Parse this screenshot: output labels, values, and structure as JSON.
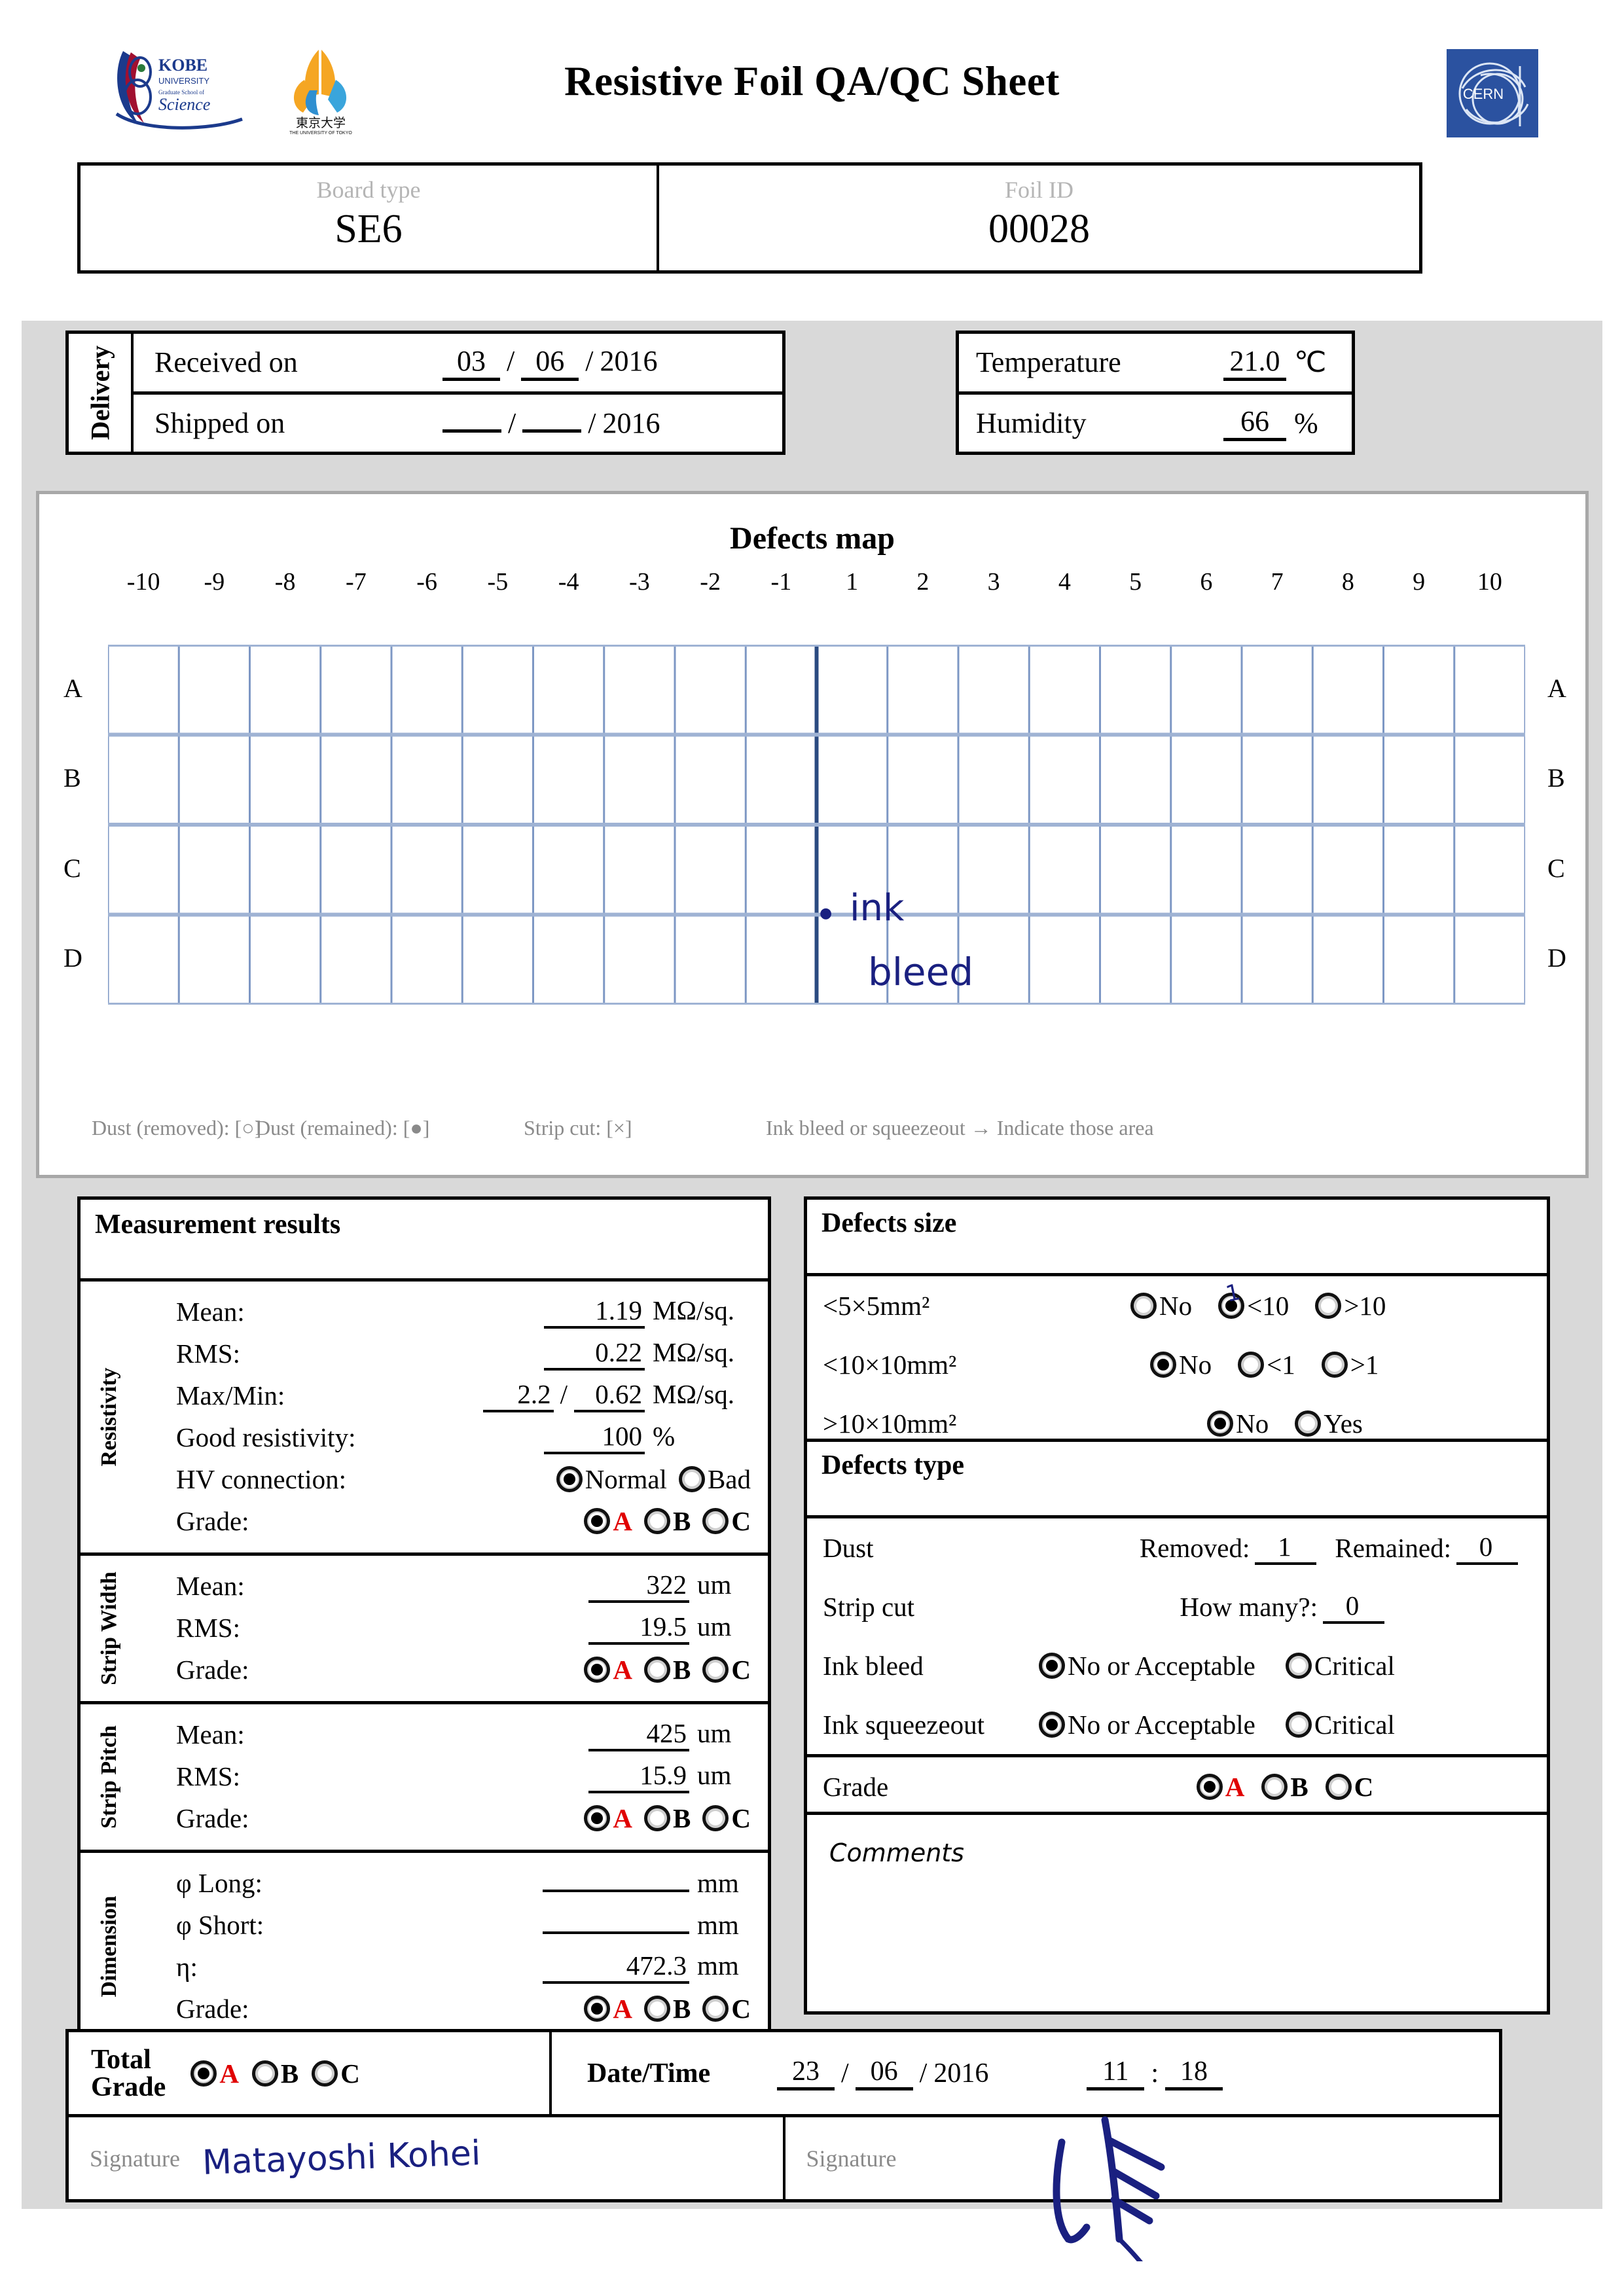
{
  "header": {
    "title": "Resistive Foil QA/QC Sheet",
    "logo_kobe": "kobe-university-logo",
    "logo_tokyo": "tokyo-university-logo",
    "logo_cern": "cern-logo",
    "cern_text": "CERN"
  },
  "identification": {
    "board_type_label": "Board type",
    "board_type_value": "SE6",
    "foil_id_label": "Foil ID",
    "foil_id_value": "00028"
  },
  "delivery": {
    "section_label": "Delivery",
    "received_label": "Received on",
    "received_day": "03",
    "received_month": "06",
    "received_year": "2016",
    "shipped_label": "Shipped on",
    "shipped_day": "",
    "shipped_month": "",
    "shipped_year": "2016"
  },
  "environment": {
    "temperature_label": "Temperature",
    "temperature_value": "21.0",
    "temperature_unit": "℃",
    "humidity_label": "Humidity",
    "humidity_value": "66",
    "humidity_unit": "%"
  },
  "defects_map": {
    "title": "Defects map",
    "columns": [
      "-10",
      "-9",
      "-8",
      "-7",
      "-6",
      "-5",
      "-4",
      "-3",
      "-2",
      "-1",
      "1",
      "2",
      "3",
      "4",
      "5",
      "6",
      "7",
      "8",
      "9",
      "10"
    ],
    "rows": [
      "A",
      "B",
      "C",
      "D"
    ],
    "annotations": [
      {
        "text": "ink",
        "row": "C",
        "col": "2"
      },
      {
        "text": "bleed",
        "row": "D",
        "col": "2"
      }
    ],
    "legend": [
      "Dust (removed): [○]",
      "Dust (remained): [●]",
      "Strip cut: [×]",
      "Ink bleed or squeezeout → Indicate those area"
    ]
  },
  "measurement": {
    "heading": "Measurement results",
    "resistivity": {
      "label": "Resistivity",
      "mean_label": "Mean:",
      "mean_value": "1.19",
      "mean_unit": "MΩ/sq.",
      "rms_label": "RMS:",
      "rms_value": "0.22",
      "rms_unit": "MΩ/sq.",
      "maxmin_label": "Max/Min:",
      "max_value": "2.2",
      "min_value": "0.62",
      "maxmin_unit": "MΩ/sq.",
      "good_label": "Good resistivity:",
      "good_value": "100",
      "good_unit": "%",
      "hv_label": "HV connection:",
      "hv_options": [
        "Normal",
        "Bad"
      ],
      "hv_selected": "Normal",
      "grade_label": "Grade:",
      "grade_options": [
        "A",
        "B",
        "C"
      ],
      "grade_selected": "A"
    },
    "strip_width": {
      "label": "Strip Width",
      "mean_label": "Mean:",
      "mean_value": "322",
      "mean_unit": "um",
      "rms_label": "RMS:",
      "rms_value": "19.5",
      "rms_unit": "um",
      "grade_label": "Grade:",
      "grade_options": [
        "A",
        "B",
        "C"
      ],
      "grade_selected": "A"
    },
    "strip_pitch": {
      "label": "Strip Pitch",
      "mean_label": "Mean:",
      "mean_value": "425",
      "mean_unit": "um",
      "rms_label": "RMS:",
      "rms_value": "15.9",
      "rms_unit": "um",
      "grade_label": "Grade:",
      "grade_options": [
        "A",
        "B",
        "C"
      ],
      "grade_selected": "A"
    },
    "dimension": {
      "label": "Dimension",
      "long_label": "φ Long:",
      "long_value": "",
      "long_unit": "mm",
      "short_label": "φ Short:",
      "short_value": "",
      "short_unit": "mm",
      "eta_label": "η:",
      "eta_value": "472.3",
      "eta_unit": "mm",
      "grade_label": "Grade:",
      "grade_options": [
        "A",
        "B",
        "C"
      ],
      "grade_selected": "A"
    }
  },
  "defects_size": {
    "heading": "Defects size",
    "rows": [
      {
        "label": "<5×5mm²",
        "options": [
          "No",
          "<10",
          ">10"
        ],
        "selected": "<10",
        "handwritten": "1"
      },
      {
        "label": "<10×10mm²",
        "options": [
          "No",
          "<1",
          ">1"
        ],
        "selected": "No",
        "handwritten": ""
      },
      {
        "label": ">10×10mm²",
        "options": [
          "No",
          "Yes"
        ],
        "selected": "No",
        "handwritten": ""
      }
    ]
  },
  "defects_type": {
    "heading": "Defects type",
    "dust_label": "Dust",
    "dust_removed_label": "Removed:",
    "dust_removed_value": "1",
    "dust_remained_label": "Remained:",
    "dust_remained_value": "0",
    "strip_cut_label": "Strip cut",
    "strip_cut_question": "How many?:",
    "strip_cut_value": "0",
    "ink_bleed_label": "Ink bleed",
    "ink_bleed_options": [
      "No or Acceptable",
      "Critical"
    ],
    "ink_bleed_selected": "No or Acceptable",
    "ink_squeezeout_label": "Ink squeezeout",
    "ink_squeezeout_options": [
      "No or Acceptable",
      "Critical"
    ],
    "ink_squeezeout_selected": "No or Acceptable",
    "grade_label": "Grade",
    "grade_options": [
      "A",
      "B",
      "C"
    ],
    "grade_selected": "A"
  },
  "comments": {
    "label": "Comments",
    "text": ""
  },
  "footer": {
    "total_grade_label_line1": "Total",
    "total_grade_label_line2": "Grade",
    "total_grade_options": [
      "A",
      "B",
      "C"
    ],
    "total_grade_selected": "A",
    "datetime_label": "Date/Time",
    "date_day": "23",
    "date_month": "06",
    "date_year": "2016",
    "time_hour": "11",
    "time_minute": "18",
    "signature_label_1": "Signature",
    "signature_value_1": "Matayoshi Kohei",
    "signature_label_2": "Signature",
    "signature_value_2": "signature-mark"
  }
}
